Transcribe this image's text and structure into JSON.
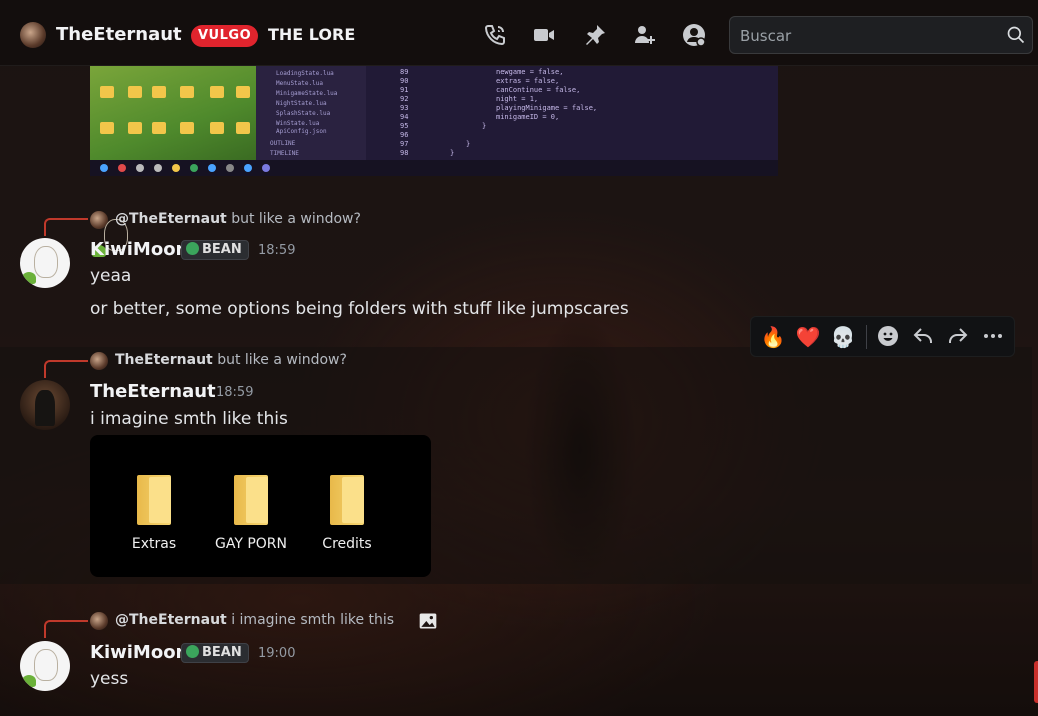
{
  "header": {
    "title": "TheEternaut",
    "tag": "VULGO",
    "subtitle": "THE LORE",
    "icons": [
      "phone-icon",
      "video-icon",
      "pin-icon",
      "add-member-icon",
      "profile-icon"
    ]
  },
  "search": {
    "placeholder": "Buscar",
    "value": ""
  },
  "colors": {
    "accent": "#e0242d",
    "reply_line": "#c0392b",
    "badge_bg": "#2b2d31"
  },
  "attachment_screenshot": {
    "sidebar_files": [
      "LoadingState.lua",
      "MenuState.lua",
      "MinigameState.lua",
      "NightState.lua",
      "SplashState.lua",
      "WinState.lua",
      "ApiConfig.json"
    ],
    "sidebar_sections": [
      "OUTLINE",
      "TIMELINE"
    ],
    "code_lines": [
      {
        "no": "89",
        "code": "newgame = false,"
      },
      {
        "no": "90",
        "code": "extras = false,"
      },
      {
        "no": "91",
        "code": "canContinue = false,"
      },
      {
        "no": "92",
        "code": "night = 1,"
      },
      {
        "no": "93",
        "code": "playingMinigame = false,"
      },
      {
        "no": "94",
        "code": "minigameID = 0,"
      },
      {
        "no": "95",
        "code": "}"
      },
      {
        "no": "96",
        "code": ""
      },
      {
        "no": "97",
        "code": "}"
      },
      {
        "no": "98",
        "code": "}"
      }
    ]
  },
  "messages": [
    {
      "reply_to_user": "@TheEternaut",
      "reply_text": "but like a window?",
      "author": "KiwiMoon",
      "badge": "BEAN",
      "time": "18:59",
      "lines": [
        "yeaa",
        "or better, some options being folders with stuff like jumpscares"
      ]
    },
    {
      "reply_to_user": "TheEternaut",
      "reply_text": "but like a window?",
      "author": "TheEternaut",
      "time": "18:59",
      "lines": [
        "i imagine smth like this"
      ],
      "attachment_folders": [
        "Extras",
        "GAY PORN",
        "Credits"
      ]
    },
    {
      "reply_to_user": "@TheEternaut",
      "reply_text": "i imagine smth like this",
      "author": "KiwiMoon",
      "badge": "BEAN",
      "time": "19:00",
      "lines": [
        "yess"
      ]
    }
  ],
  "reaction_bar": {
    "emojis": [
      "🔥",
      "❤️",
      "💀"
    ],
    "actions": [
      "add-reaction-icon",
      "reply-icon",
      "forward-icon",
      "more-icon"
    ]
  }
}
